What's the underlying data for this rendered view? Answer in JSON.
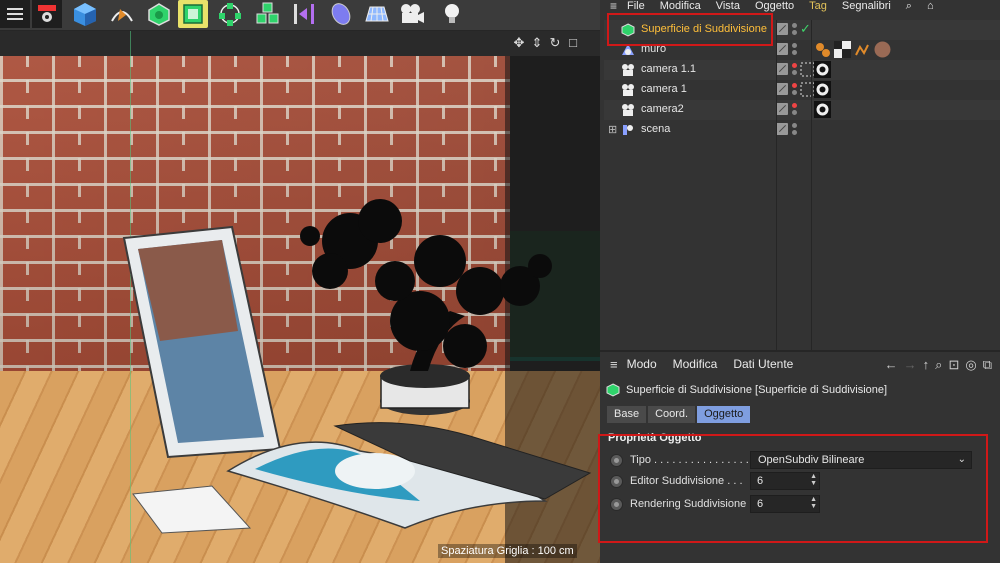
{
  "toolbar": {
    "tools": [
      {
        "icon": "hamburger-menu-icon"
      },
      {
        "icon": "render-settings-icon"
      },
      {
        "icon": "cube-primitive-icon"
      },
      {
        "icon": "pen-spline-icon"
      },
      {
        "icon": "subdivision-surface-icon"
      },
      {
        "icon": "subdivision-surface-active-icon"
      },
      {
        "icon": "array-generator-icon"
      },
      {
        "icon": "cloner-icon"
      },
      {
        "icon": "deformer-icon"
      },
      {
        "icon": "field-icon"
      },
      {
        "icon": "floor-icon"
      },
      {
        "icon": "camera-icon"
      },
      {
        "icon": "light-bulb-icon"
      }
    ]
  },
  "viewport": {
    "grid_label": "Spaziatura Griglia : 100 cm"
  },
  "object_manager": {
    "menu": [
      "File",
      "Modifica",
      "Vista",
      "Oggetto",
      "Tag",
      "Segnalibri"
    ],
    "objects": [
      {
        "name": "Superficie di Suddivisione",
        "icon": "subdivision-surface-icon",
        "active": true,
        "check": "✓"
      },
      {
        "name": "muro",
        "icon": "null-object-icon"
      },
      {
        "name": "camera 1.1",
        "icon": "camera-icon"
      },
      {
        "name": "camera 1",
        "icon": "camera-icon"
      },
      {
        "name": "camera2",
        "icon": "camera-icon"
      },
      {
        "name": "scena",
        "icon": "scene-null-icon"
      }
    ],
    "accent_color": "#ffbf3a"
  },
  "attribute_manager": {
    "menu": [
      "Modo",
      "Modifica",
      "Dati Utente"
    ],
    "title": "Superficie di Suddivisione [Superficie di Suddivisione]",
    "tabs": [
      "Base",
      "Coord.",
      "Oggetto"
    ],
    "active_tab": "Oggetto",
    "section": "Proprietà Oggetto",
    "props": {
      "tipo_label": "Tipo . . . . . . . . . . . . . . . .",
      "tipo_value": "OpenSubdiv Bilineare",
      "editor_label": "Editor Suddivisione . . .",
      "editor_value": "6",
      "render_label": "Rendering Suddivisione",
      "render_value": "6"
    },
    "active_tab_color": "#7f9ee0"
  },
  "highlight_color": "#d01818"
}
